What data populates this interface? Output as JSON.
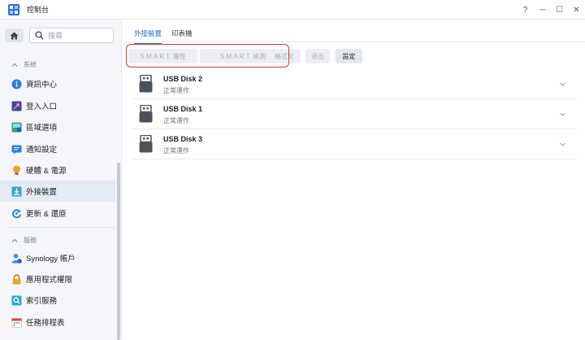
{
  "window": {
    "title": "控制台",
    "controls": [
      "?",
      "─",
      "☐",
      "✕"
    ]
  },
  "sidebar": {
    "search": {
      "placeholder": "搜尋",
      "value": ""
    },
    "sections": [
      {
        "label": "系統",
        "items": [
          {
            "label": "資訊中心",
            "icon": "info-icon"
          },
          {
            "label": "登入入口",
            "icon": "login-portal-icon"
          },
          {
            "label": "區域選項",
            "icon": "regional-options-icon"
          },
          {
            "label": "通知設定",
            "icon": "notification-icon"
          },
          {
            "label": "硬體 & 電源",
            "icon": "hardware-power-icon"
          },
          {
            "label": "外接裝置",
            "icon": "external-devices-icon",
            "active": true
          },
          {
            "label": "更新 & 還原",
            "icon": "update-restore-icon"
          }
        ]
      },
      {
        "label": "服務",
        "items": [
          {
            "label": "Synology 帳戶",
            "icon": "synology-account-icon"
          },
          {
            "label": "應用程式權限",
            "icon": "app-privileges-icon"
          },
          {
            "label": "索引服務",
            "icon": "indexing-service-icon"
          },
          {
            "label": "任務排程表",
            "icon": "task-scheduler-icon"
          }
        ]
      }
    ]
  },
  "main": {
    "tabs": [
      {
        "label": "外接裝置",
        "active": true
      },
      {
        "label": "印表機",
        "active": false
      }
    ],
    "toolbar": {
      "smart_attributes": "S.M.A.R.T. 屬性",
      "smart_test": "S.M.A.R.T. 檢測",
      "format": "格式化",
      "eject": "退出",
      "settings": "設定"
    },
    "devices": [
      {
        "name": "USB Disk 2",
        "status": "正常運作"
      },
      {
        "name": "USB Disk 1",
        "status": "正常運作"
      },
      {
        "name": "USB Disk 3",
        "status": "正常運作"
      }
    ]
  },
  "colors": {
    "accent": "#1a6fd1",
    "highlight": "#d23a2d",
    "sidebar_bg": "#f4f6f9",
    "active_item_bg": "#e4ebf5"
  }
}
